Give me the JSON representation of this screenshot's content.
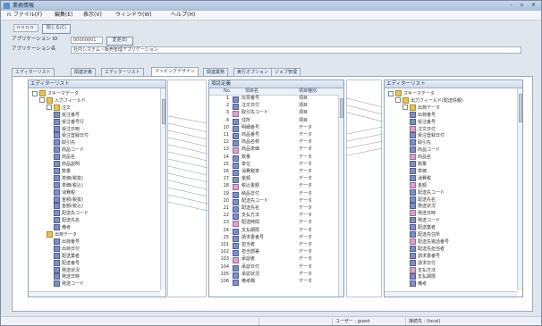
{
  "window": {
    "title": "業務情報",
    "controls": [
      "–",
      "▫",
      "✕"
    ]
  },
  "menu": {
    "items": [
      "ｎ ファイル(F)",
      "編集(E)",
      "表示(V)",
      "ウィンドウ(W)",
      "ヘルプ(H)"
    ]
  },
  "toolbar": {
    "tab_label": "ｎｎｎｎ",
    "button_label": "閉じる(C)"
  },
  "form": {
    "field1_label": "アプリケーション ID",
    "field1_value": "00000001",
    "field1_button": "変更(E)",
    "field2_label": "アプリケーション名",
    "field2_value": "社内システム・販売管理アプリケーション"
  },
  "tabs": [
    "エディターリスト",
    "関連定義",
    "エディターリスト",
    "マッピングデザイン",
    "関連業務",
    "実行オプション",
    "ジョブ管理"
  ],
  "left_panel": {
    "title": "エディターリスト",
    "items": [
      "スキーマデータ",
      "入力フィールド",
      "注文",
      "受注番号",
      "受注番号行",
      "受注日時",
      "受注登録日付",
      "取引先",
      "商品コード",
      "商品名",
      "商品説明",
      "数量",
      "単価(税抜)",
      "単価(税込)",
      "消費税",
      "金額(税抜)",
      "金額(税込)",
      "配送先コード",
      "配送先名",
      "備考",
      "出荷データ",
      "出荷番号",
      "出荷日付",
      "配送業者",
      "配送番号",
      "発送状況",
      "発送日時",
      "発送コード"
    ]
  },
  "mid_panel": {
    "title": "項目定義",
    "col_no": "No.",
    "col_name": "項目名",
    "col_type": "項目種別",
    "rows": [
      {
        "no": "1",
        "name": "伝票番号",
        "type": "項目"
      },
      {
        "no": "2",
        "name": "注文日付",
        "type": "項目"
      },
      {
        "no": "3",
        "name": "取引先コード",
        "type": "項目"
      },
      {
        "no": "4",
        "name": "住所",
        "type": "項目"
      },
      {
        "no": "10",
        "name": "明細番号",
        "type": "データ"
      },
      {
        "no": "11",
        "name": "商品番号",
        "type": "データ"
      },
      {
        "no": "12",
        "name": "商品名称",
        "type": "データ"
      },
      {
        "no": "13",
        "name": "商品単価",
        "type": "データ"
      },
      {
        "no": "14",
        "name": "数量",
        "type": "データ"
      },
      {
        "no": "15",
        "name": "単位",
        "type": "データ"
      },
      {
        "no": "16",
        "name": "消費税率",
        "type": "データ"
      },
      {
        "no": "17",
        "name": "金額",
        "type": "データ"
      },
      {
        "no": "18",
        "name": "税込金額",
        "type": "データ"
      },
      {
        "no": "19",
        "name": "納品日付",
        "type": "データ"
      },
      {
        "no": "20",
        "name": "配送先コード",
        "type": "データ"
      },
      {
        "no": "21",
        "name": "配送先名",
        "type": "データ"
      },
      {
        "no": "22",
        "name": "支払方法",
        "type": "データ"
      },
      {
        "no": "23",
        "name": "配送時間",
        "type": "データ"
      },
      {
        "no": "24",
        "name": "支払期限",
        "type": "データ"
      },
      {
        "no": "25",
        "name": "請求書番号",
        "type": "データ"
      },
      {
        "no": "101",
        "name": "担当者",
        "type": "データ"
      },
      {
        "no": "102",
        "name": "担当部署",
        "type": "データ"
      },
      {
        "no": "103",
        "name": "承認者",
        "type": "データ"
      },
      {
        "no": "104",
        "name": "承認日付",
        "type": "データ"
      },
      {
        "no": "105",
        "name": "承認状況",
        "type": "データ"
      },
      {
        "no": "106",
        "name": "備考欄",
        "type": "データ"
      }
    ]
  },
  "right_panel": {
    "title": "エディターリスト",
    "items": [
      "スキーマデータ",
      "出力フィールド(配送情報)",
      "出荷データ",
      "出荷番号",
      "受注番号",
      "注文日付",
      "受注登録日付",
      "取引先",
      "商品コード",
      "商品名",
      "数量",
      "単価",
      "消費税",
      "金額",
      "配送先コード",
      "配送先名",
      "発送状況",
      "発送日時",
      "発送コード",
      "配送業者",
      "配送先住所",
      "配送先電話番号",
      "配送先担当者",
      "請求書番号",
      "請求日付",
      "支払方法",
      "支払期限",
      "備考"
    ]
  },
  "status": {
    "cell1": "",
    "cell2": "ユーザー : guest",
    "cell3": "接続先 : (local)"
  }
}
